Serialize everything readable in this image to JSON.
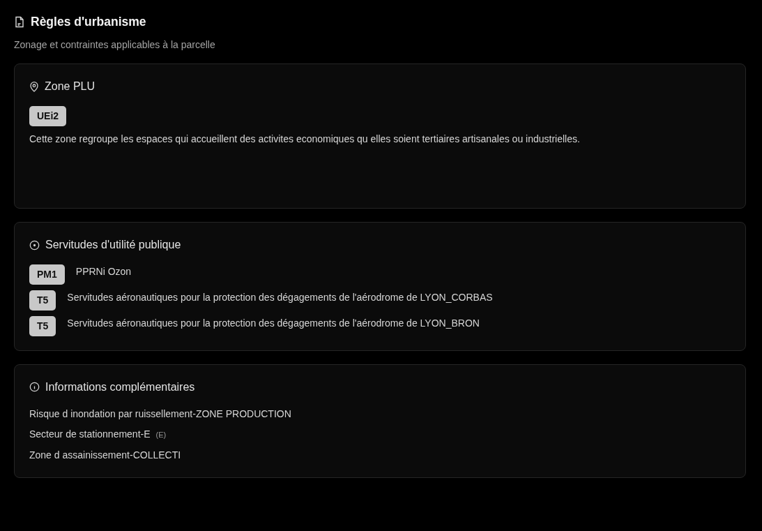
{
  "header": {
    "title": "Règles d'urbanisme",
    "subtitle": "Zonage et contraintes applicables à la parcelle"
  },
  "zone_plu": {
    "title": "Zone PLU",
    "badge": "UEi2",
    "description": "Cette zone regroupe les espaces qui accueillent des activites economiques qu elles soient tertiaires artisanales ou industrielles."
  },
  "servitudes": {
    "title": "Servitudes d'utilité publique",
    "items": [
      {
        "code": "PM1",
        "label": "PPRNi Ozon"
      },
      {
        "code": "T5",
        "label": "Servitudes aéronautiques pour la protection des dégagements de l'aérodrome de LYON_CORBAS"
      },
      {
        "code": "T5",
        "label": "Servitudes aéronautiques pour la protection des dégagements de l'aérodrome de LYON_BRON"
      }
    ]
  },
  "informations": {
    "title": "Informations complémentaires",
    "items": [
      {
        "label": "Risque d inondation par ruissellement-ZONE PRODUCTION"
      },
      {
        "label": "Secteur de stationnement-E",
        "code": "(E)"
      },
      {
        "label": "Zone d assainissement-COLLECTI"
      }
    ]
  }
}
